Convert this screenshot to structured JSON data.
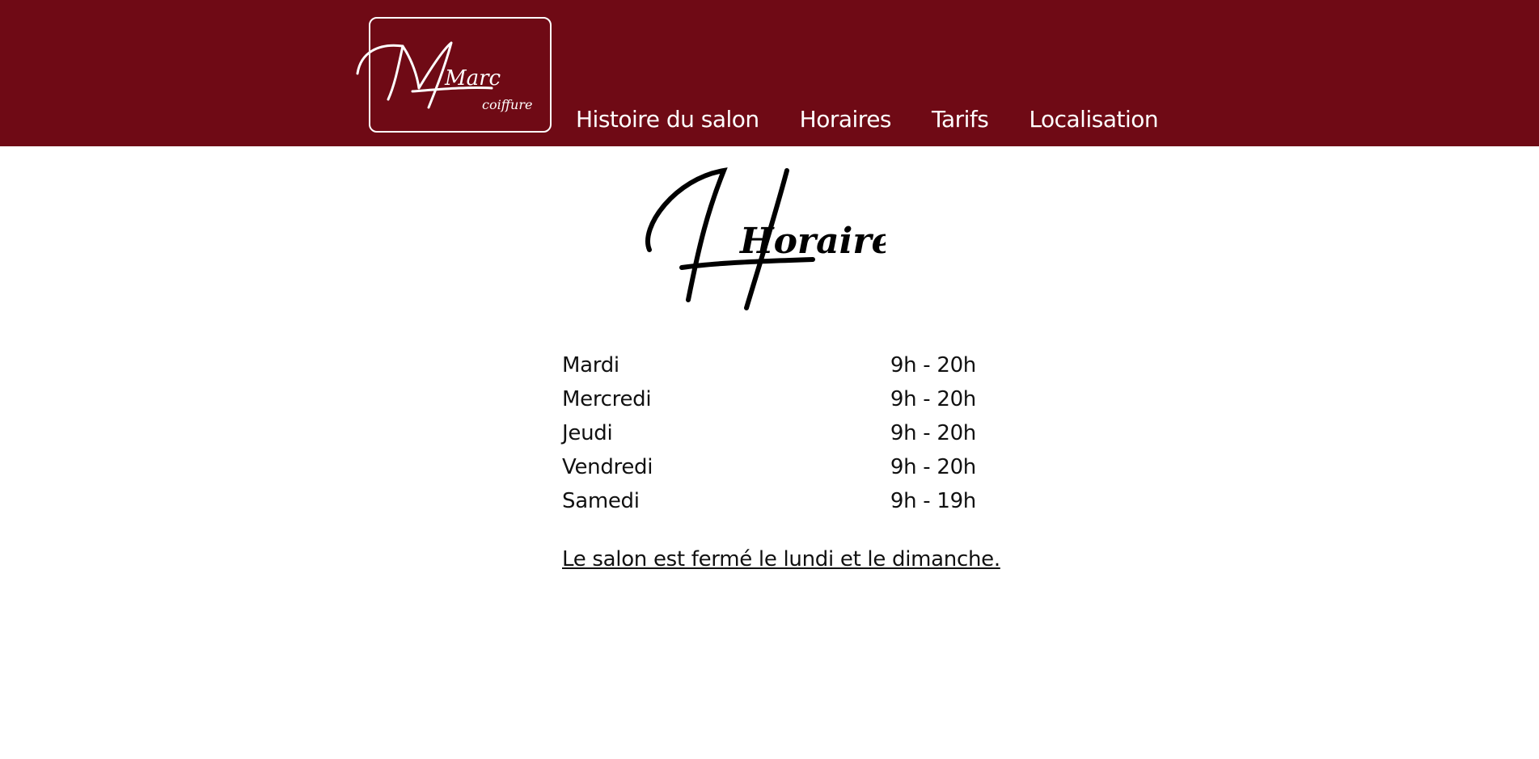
{
  "brand": {
    "logo_primary": "Marc",
    "logo_secondary": "coiffure"
  },
  "nav": {
    "items": [
      {
        "label": "Histoire du salon"
      },
      {
        "label": "Horaires"
      },
      {
        "label": "Tarifs"
      },
      {
        "label": "Localisation"
      }
    ]
  },
  "page": {
    "title": "Horaires"
  },
  "hours": [
    {
      "day": "Mardi",
      "time": "9h - 20h"
    },
    {
      "day": "Mercredi",
      "time": "9h - 20h"
    },
    {
      "day": "Jeudi",
      "time": "9h - 20h"
    },
    {
      "day": "Vendredi",
      "time": "9h - 20h"
    },
    {
      "day": "Samedi",
      "time": "9h - 19h"
    }
  ],
  "note": "Le salon est fermé le lundi et le dimanche.",
  "colors": {
    "header_bg": "#6f0a15",
    "text": "#111111",
    "header_text": "#ffffff"
  }
}
